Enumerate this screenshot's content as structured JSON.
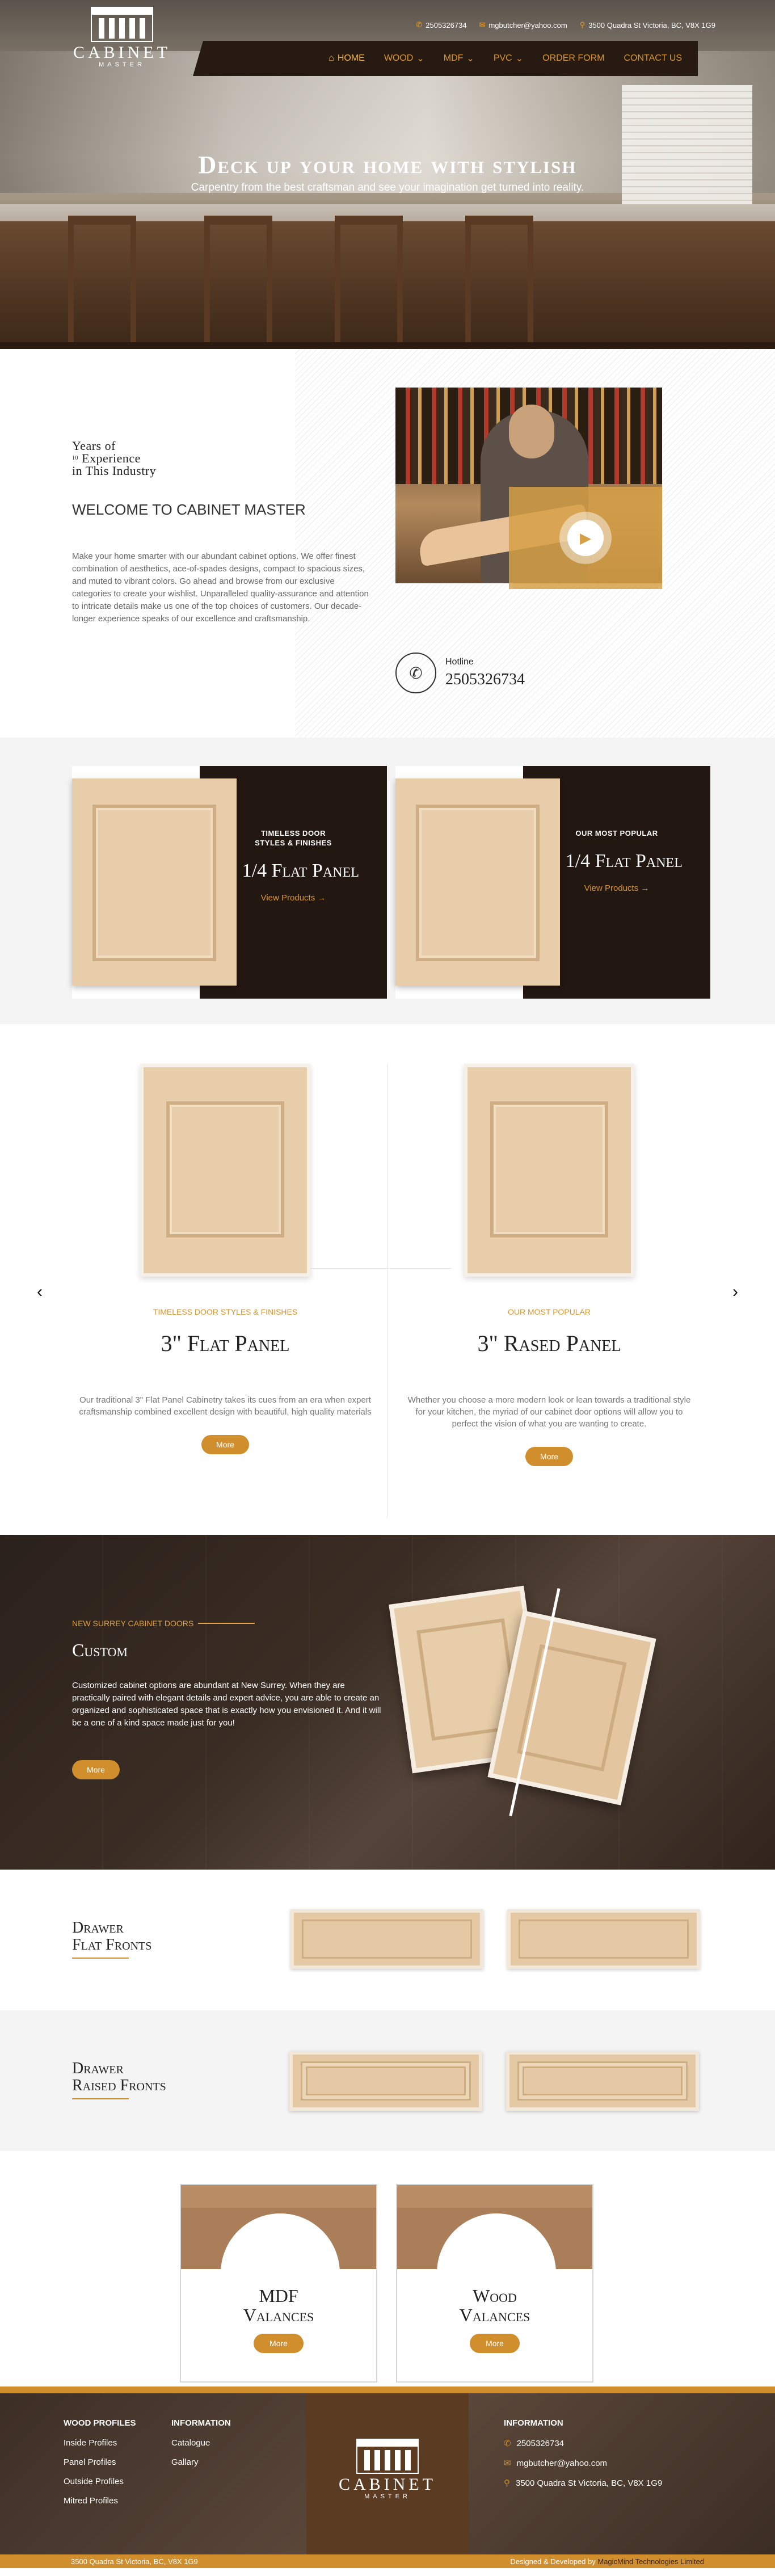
{
  "topbar": {
    "phone": "2505326734",
    "email": "mgbutcher@yahoo.com",
    "address": "3500 Quadra St Victoria, BC, V8X 1G9"
  },
  "logo": {
    "name": "CABINET",
    "sub": "MASTER"
  },
  "nav": [
    {
      "label": "HOME",
      "active": true,
      "dropdown": false
    },
    {
      "label": "WOOD",
      "dropdown": true
    },
    {
      "label": "MDF",
      "dropdown": true
    },
    {
      "label": "PVC",
      "dropdown": true
    },
    {
      "label": "ORDER FORM",
      "dropdown": false
    },
    {
      "label": "CONTACT US",
      "dropdown": false
    }
  ],
  "hero": {
    "title": "Deck up your home with stylish",
    "subtitle": "Carpentry from the best craftsman and see your imagination get turned into reality."
  },
  "welcome": {
    "years_line1": "Years of",
    "years_num": "10",
    "years_line2": "Experience",
    "years_line3": "in This Industry",
    "heading": "WELCOME TO CABINET MASTER",
    "body": "Make your home smarter with our abundant cabinet options. We offer finest combination of aesthetics, ace-of-spades designs, compact to spacious sizes, and muted to vibrant colors. Go ahead and browse from our exclusive categories to create your wishlist. Unparalleled quality-assurance and attention to intricate details make us one of the top choices of customers. Our decade-longer experience speaks of our excellence and craftsmanship.",
    "hotline_label": "Hotline",
    "hotline_number": "2505326734"
  },
  "cards": [
    {
      "kicker": "TIMELESS DOOR STYLES & FINISHES",
      "title": "2 1/4 Flat Panel",
      "link": "View Products →"
    },
    {
      "kicker": "OUR MOST POPULAR",
      "title": "2 1/4 Flat Panel",
      "link": "View Products →"
    }
  ],
  "slider": {
    "prev": "‹",
    "next": "›",
    "slides": [
      {
        "kicker": "TIMELESS DOOR STYLES & FINISHES",
        "title": "3\" Flat Panel",
        "desc": "Our traditional 3\" Flat Panel Cabinetry takes its cues from an era when expert craftsmanship combined excellent design with beautiful, high quality materials",
        "button": "More"
      },
      {
        "kicker": "OUR MOST POPULAR",
        "title": "3\" Rased Panel",
        "desc": "Whether you choose a more modern look or lean towards a traditional style for your kitchen, the myriad of our cabinet door options will allow you to perfect the vision of what you are wanting to create.",
        "button": "More"
      }
    ]
  },
  "custom": {
    "kicker": "NEW SURREY CABINET DOORS",
    "title": "Custom",
    "body": "Customized cabinet options are abundant at New Surrey. When they are practically paired with elegant details and expert advice, you are able to create an organized and sophisticated space that is exactly how you envisioned it. And it will be a one of a kind space made just for you!",
    "button": "More"
  },
  "drawers": [
    {
      "line1": "Drawer",
      "line2": "Flat Fronts"
    },
    {
      "line1": "Drawer",
      "line2": "Raised Fronts"
    }
  ],
  "valances": [
    {
      "line1": "MDF",
      "line2": "Valances",
      "button": "More"
    },
    {
      "line1": "Wood",
      "line2": "Valances",
      "button": "More"
    }
  ],
  "footer": {
    "col1_title": "WOOD PROFILES",
    "col1_items": [
      "Inside Profiles",
      "Panel Profiles",
      "Outside Profiles",
      "Mitred Profiles"
    ],
    "col2_title": "INFORMATION",
    "col2_items": [
      "Catalogue",
      "Gallary"
    ],
    "col3_title": "INFORMATION",
    "phone": "2505326734",
    "email": "mgbutcher@yahoo.com",
    "address": "3500 Quadra St Victoria, BC, V8X 1G9",
    "bar_left": "3500 Quadra St Victoria, BC, V8X 1G9",
    "bar_right_prefix": "Designed & Developed by ",
    "bar_right_brand": "MagicMind Technologies Limited"
  },
  "colors": {
    "accent": "#d08e2c",
    "dark": "#231712"
  }
}
